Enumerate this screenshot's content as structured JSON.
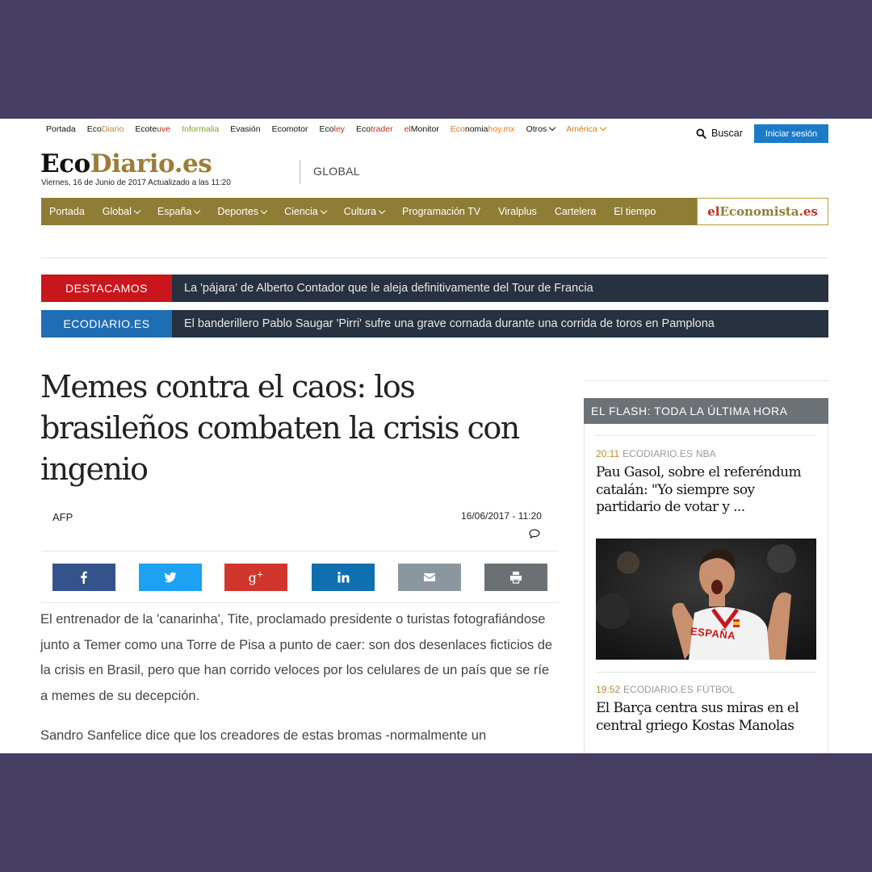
{
  "topnav": {
    "portada": "Portada",
    "ecodiario_a": "Eco",
    "ecodiario_b": "Diario",
    "ecoteuve_a": "Ecote",
    "ecoteuve_b": "uve",
    "informalia": "Informalia",
    "evasion": "Evasión",
    "ecomotor": "Ecomotor",
    "ecoley_a": "Eco",
    "ecoley_b": "ley",
    "ecotrader_a": "Eco",
    "ecotrader_b": "trader",
    "elmonitor_a": "el",
    "elmonitor_b": "Monitor",
    "economiahoy_a": "Eco",
    "economiahoy_b": "nomia",
    "economiahoy_c": "hoy.mx",
    "otros": "Otros",
    "america": "América"
  },
  "header": {
    "search_label": "Buscar",
    "login_label": "Iniciar sesión",
    "logo_eco": "Eco",
    "logo_diario": "Diario",
    "logo_es": ".es",
    "dateline": "Viernes, 16 de Junio de 2017 Actualizado a las 11:20",
    "section": "GLOBAL"
  },
  "mainnav": {
    "items": [
      "Portada",
      "Global",
      "España",
      "Deportes",
      "Ciencia",
      "Cultura",
      "Programación TV",
      "Viralplus",
      "Cartelera",
      "El tiempo"
    ],
    "eleconomista_a": "el",
    "eleconomista_b": "Economista",
    "eleconomista_c": ".es"
  },
  "tickers": [
    {
      "tag": "DESTACAMOS",
      "color": "#c8161c",
      "text": "La 'pájara' de Alberto Contador que le aleja definitivamente del Tour de Francia"
    },
    {
      "tag": "ECODIARIO.ES",
      "color": "#1f6eb3",
      "text": "El banderillero Pablo Saugar 'Pirri' sufre una grave cornada durante una corrida de toros en Pamplona"
    }
  ],
  "article": {
    "headline": "Memes contra el caos: los brasileños combaten la crisis con ingenio",
    "author": "AFP",
    "date": "16/06/2017 - 11:20",
    "paragraphs": [
      "El entrenador de la 'canarinha', Tite, proclamado presidente o turistas fotografiándose junto a Temer como una Torre de Pisa a punto de caer: son dos desenlaces ficticios de la crisis en Brasil, pero que han corrido veloces por los celulares de un país que se ríe a memes de su decepción.",
      "Sandro Sanfelice dice que los creadores de estas bromas -normalmente un fotomontaje con un chascarrillo político- son periodistas o humoristas del"
    ]
  },
  "share": [
    {
      "name": "facebook",
      "color": "#34538d",
      "icon": "facebook-icon"
    },
    {
      "name": "twitter",
      "color": "#1da1f2",
      "icon": "twitter-icon"
    },
    {
      "name": "googleplus",
      "color": "#d0372c",
      "icon": "googleplus-icon"
    },
    {
      "name": "linkedin",
      "color": "#0f70b1",
      "icon": "linkedin-icon"
    },
    {
      "name": "email",
      "color": "#8b979f",
      "icon": "mail-icon"
    },
    {
      "name": "print",
      "color": "#6a7074",
      "icon": "print-icon"
    }
  ],
  "sidebar": {
    "title": "EL FLASH: TODA LA ÚLTIMA HORA",
    "items": [
      {
        "time": "20:11",
        "source": "ECODIARIO.ES",
        "section": "NBA",
        "title": "Pau Gasol, sobre el referéndum catalán: \"Yo siempre soy partidario de votar y ..."
      },
      {
        "time": "19:52",
        "source": "ECODIARIO.ES",
        "section": "FÚTBOL",
        "title": "El Barça centra sus miras en el central griego Kostas Manolas"
      }
    ],
    "photo_text": "ESPAÑA"
  }
}
